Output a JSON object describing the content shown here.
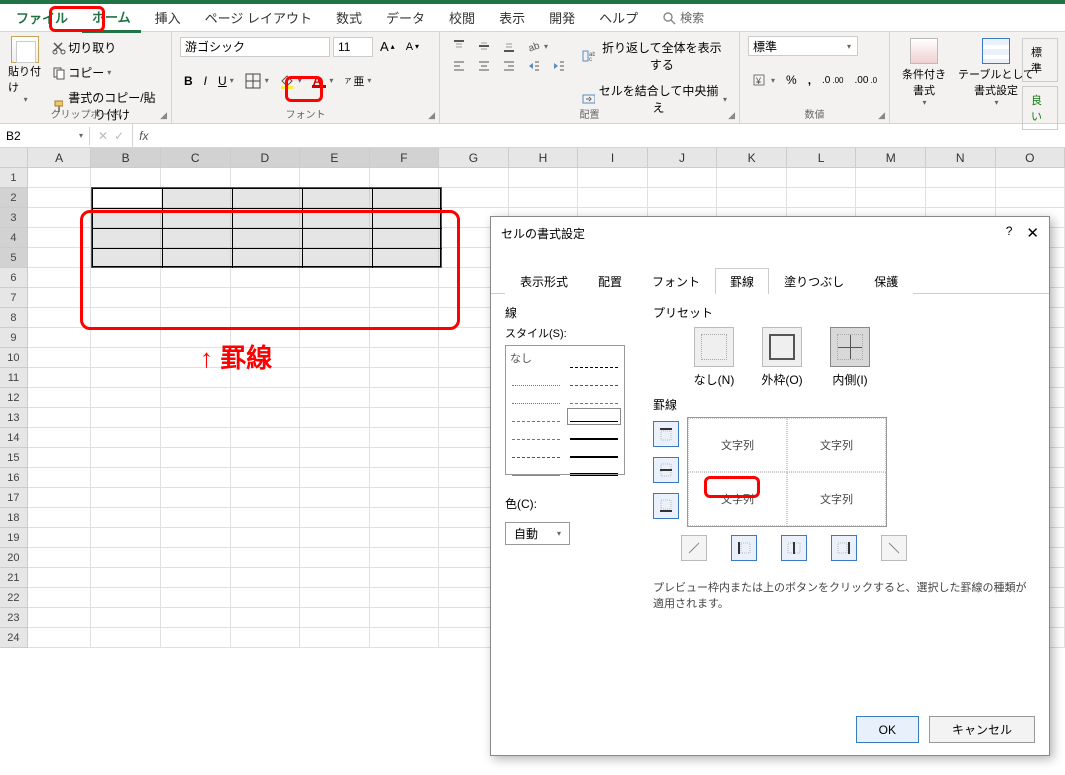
{
  "menu": {
    "file": "ファイル",
    "home": "ホーム",
    "insert": "挿入",
    "layout": "ページ レイアウト",
    "formulas": "数式",
    "data": "データ",
    "review": "校閲",
    "view": "表示",
    "dev": "開発",
    "help": "ヘルプ",
    "search": "検索"
  },
  "ribbon": {
    "clipboard": {
      "paste": "貼り付け",
      "cut": "切り取り",
      "copy": "コピー",
      "fmtpaint": "書式のコピー/貼り付け",
      "label": "クリップボード"
    },
    "font": {
      "name": "游ゴシック",
      "size": "11",
      "label": "フォント"
    },
    "align": {
      "wrap": "折り返して全体を表示する",
      "merge": "セルを結合して中央揃え",
      "label": "配置"
    },
    "number": {
      "fmt": "標準",
      "label": "数値"
    },
    "styles": {
      "cond": "条件付き\n書式",
      "table": "テーブルとして\n書式設定",
      "stdlabel": "標準",
      "goodlabel": "良い"
    }
  },
  "namebox": "B2",
  "cols": [
    "A",
    "B",
    "C",
    "D",
    "E",
    "F",
    "G",
    "H",
    "I",
    "J",
    "K",
    "L",
    "M",
    "N",
    "O"
  ],
  "annotation": "↑ 罫線",
  "dialog": {
    "title": "セルの書式設定",
    "tabs": {
      "num": "表示形式",
      "align": "配置",
      "font": "フォント",
      "border": "罫線",
      "fill": "塗りつぶし",
      "protect": "保護"
    },
    "line": "線",
    "style": "スタイル(S):",
    "none": "なし",
    "color": "色(C):",
    "auto": "自動",
    "preset": "プリセット",
    "presets": {
      "none": "なし(N)",
      "outer": "外枠(O)",
      "inner": "内側(I)"
    },
    "border": "罫線",
    "celltext": "文字列",
    "help": "プレビュー枠内または上のボタンをクリックすると、選択した罫線の種類が適用されます。",
    "ok": "OK",
    "cancel": "キャンセル"
  }
}
